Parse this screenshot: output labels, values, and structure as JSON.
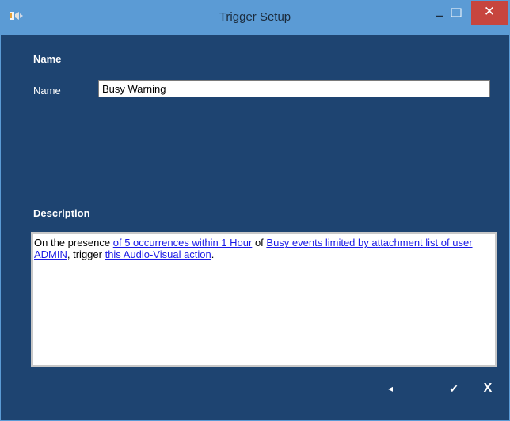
{
  "window": {
    "title": "Trigger Setup"
  },
  "titlebar_controls": {
    "minimize": "–",
    "close": "✕"
  },
  "name_section": {
    "heading": "Name",
    "field_label": "Name",
    "field_value": "Busy Warning"
  },
  "description_section": {
    "heading": "Description",
    "parts": {
      "t1": "On the presence ",
      "l1": "of 5 occurrences within 1 Hour",
      "t2": " of ",
      "l2": "Busy events limited by attachment list of user ADMIN",
      "t3": ", trigger ",
      "l3": "this Audio-Visual action",
      "t4": "."
    }
  },
  "footer": {
    "back": "◂",
    "ok": "✔",
    "cancel": "X"
  },
  "colors": {
    "window_bg": "#1e4471",
    "titlebar_bg": "#5b9bd5",
    "close_bg": "#c7453e",
    "link": "#1a1ae6"
  },
  "icons": {
    "app": "speaker-wave-icon",
    "maximize": "maximize-icon"
  }
}
